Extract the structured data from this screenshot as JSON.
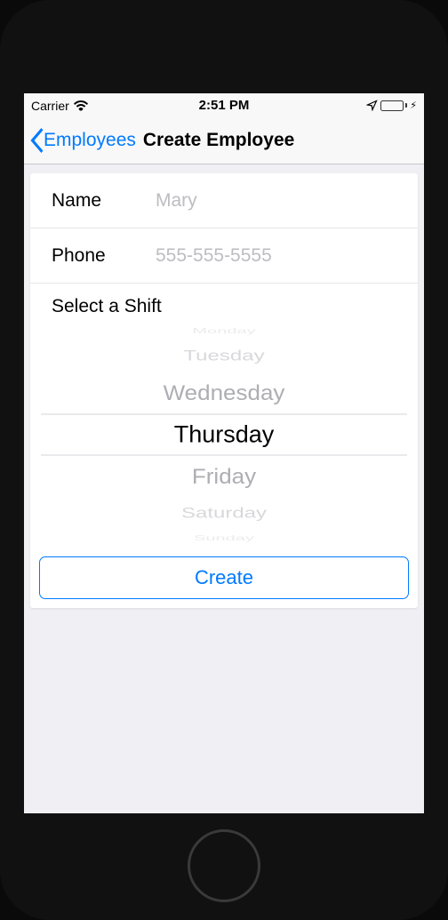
{
  "status_bar": {
    "carrier": "Carrier",
    "time": "2:51 PM",
    "location_services": true,
    "battery_charging": true
  },
  "nav": {
    "back_label": "Employees",
    "title": "Create Employee"
  },
  "form": {
    "name_label": "Name",
    "name_placeholder": "Mary",
    "name_value": "",
    "phone_label": "Phone",
    "phone_placeholder": "555-555-5555",
    "phone_value": "",
    "shift_label": "Select a Shift"
  },
  "picker": {
    "options": [
      "Monday",
      "Tuesday",
      "Wednesday",
      "Thursday",
      "Friday",
      "Saturday",
      "Sunday"
    ],
    "selected": "Thursday"
  },
  "submit": {
    "label": "Create"
  }
}
